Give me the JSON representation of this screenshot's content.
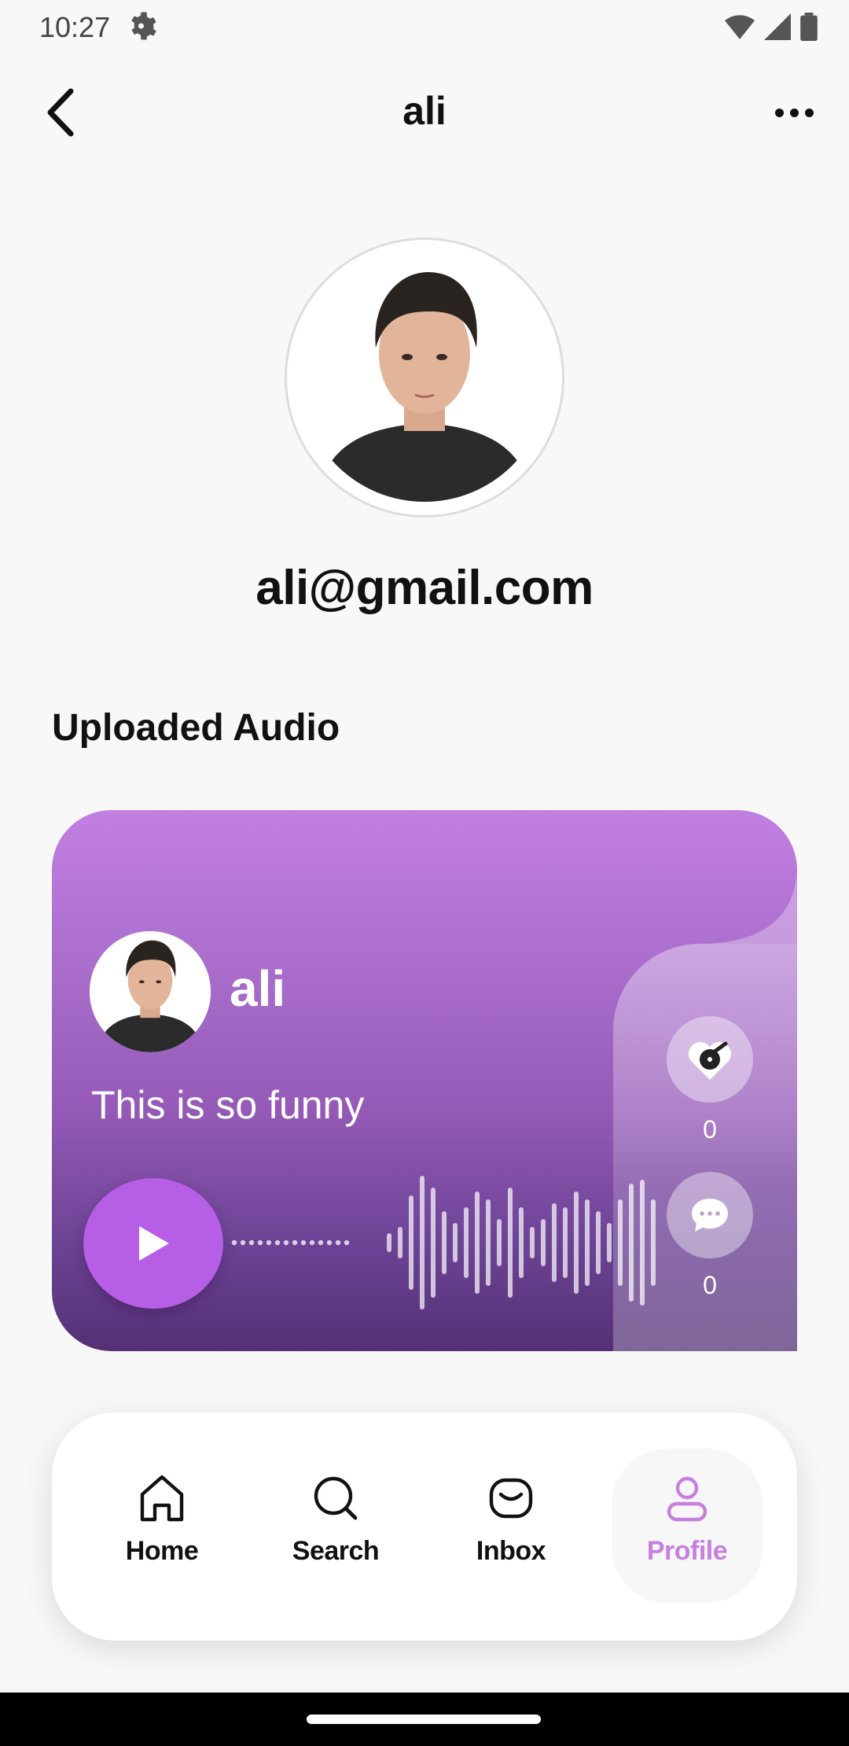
{
  "status_bar": {
    "time": "10:27"
  },
  "header": {
    "title": "ali"
  },
  "profile": {
    "email": "ali@gmail.com"
  },
  "section": {
    "title": "Uploaded Audio"
  },
  "audio_card": {
    "username": "ali",
    "caption": "This is so funny",
    "likes": "0",
    "comments": "0"
  },
  "bottom_nav": {
    "items": [
      {
        "label": "Home",
        "icon": "home-icon"
      },
      {
        "label": "Search",
        "icon": "search-icon"
      },
      {
        "label": "Inbox",
        "icon": "inbox-icon"
      },
      {
        "label": "Profile",
        "icon": "profile-icon",
        "active": true
      }
    ]
  },
  "colors": {
    "accent": "#b65ee6",
    "active_nav": "#c77fe0",
    "card_top": "#c27fe2",
    "card_bottom": "#553075"
  }
}
